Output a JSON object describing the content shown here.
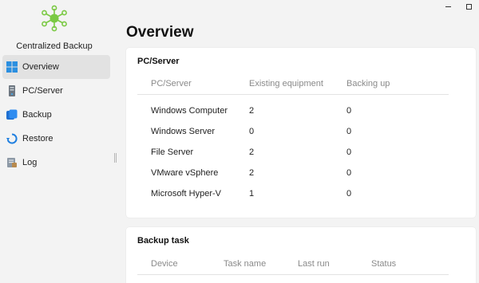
{
  "app": {
    "name": "Centralized Backup",
    "accent": "#7ac943"
  },
  "window_controls": [
    "minimize",
    "maximize"
  ],
  "sidebar": {
    "items": [
      {
        "label": "Overview",
        "icon": "windows-grid-icon",
        "active": true
      },
      {
        "label": "PC/Server",
        "icon": "server-icon",
        "active": false
      },
      {
        "label": "Backup",
        "icon": "backup-icon",
        "active": false
      },
      {
        "label": "Restore",
        "icon": "restore-icon",
        "active": false
      },
      {
        "label": "Log",
        "icon": "log-icon",
        "active": false
      }
    ]
  },
  "main": {
    "title": "Overview",
    "pc_server": {
      "title": "PC/Server",
      "columns": [
        "PC/Server",
        "Existing equipment",
        "Backing up"
      ],
      "rows": [
        {
          "name": "Windows Computer",
          "existing": "2",
          "backing_up": "0"
        },
        {
          "name": "Windows Server",
          "existing": "0",
          "backing_up": "0"
        },
        {
          "name": "File Server",
          "existing": "2",
          "backing_up": "0"
        },
        {
          "name": "VMware vSphere",
          "existing": "2",
          "backing_up": "0"
        },
        {
          "name": "Microsoft Hyper-V",
          "existing": "1",
          "backing_up": "0"
        }
      ]
    },
    "backup_task": {
      "title": "Backup task",
      "columns": [
        "Device",
        "Task name",
        "Last run",
        "Status"
      ]
    }
  }
}
